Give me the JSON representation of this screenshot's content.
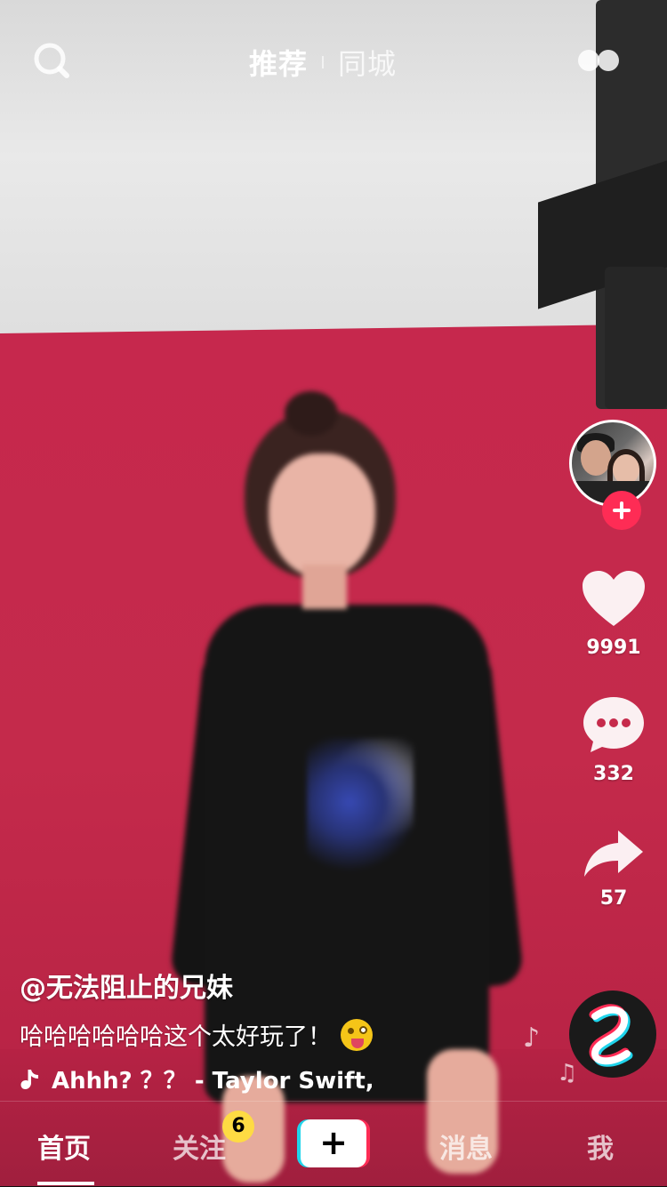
{
  "top_nav": {
    "tab_recommended": "推荐",
    "tab_nearby": "同城",
    "search_icon": "search-icon",
    "live_icon": "two-dots-icon"
  },
  "actions": {
    "avatar_icon": "user-avatar",
    "follow_icon": "plus-icon",
    "like_count": "9991",
    "comment_count": "332",
    "share_count": "57"
  },
  "caption": {
    "author": "@无法阻止的兄妹",
    "description": "哈哈哈哈哈哈这个太好玩了！",
    "emoji": "winking-tongue-emoji",
    "music": "Ahhh? ？？  - Taylor Swift,"
  },
  "bottom_nav": {
    "home": "首页",
    "following": "关注",
    "following_badge": "6",
    "create": "+",
    "messages": "消息",
    "me": "我"
  },
  "colors": {
    "accent_red": "#fe2c55",
    "accent_cyan": "#20d5ec",
    "badge_yellow": "#fedb43"
  }
}
